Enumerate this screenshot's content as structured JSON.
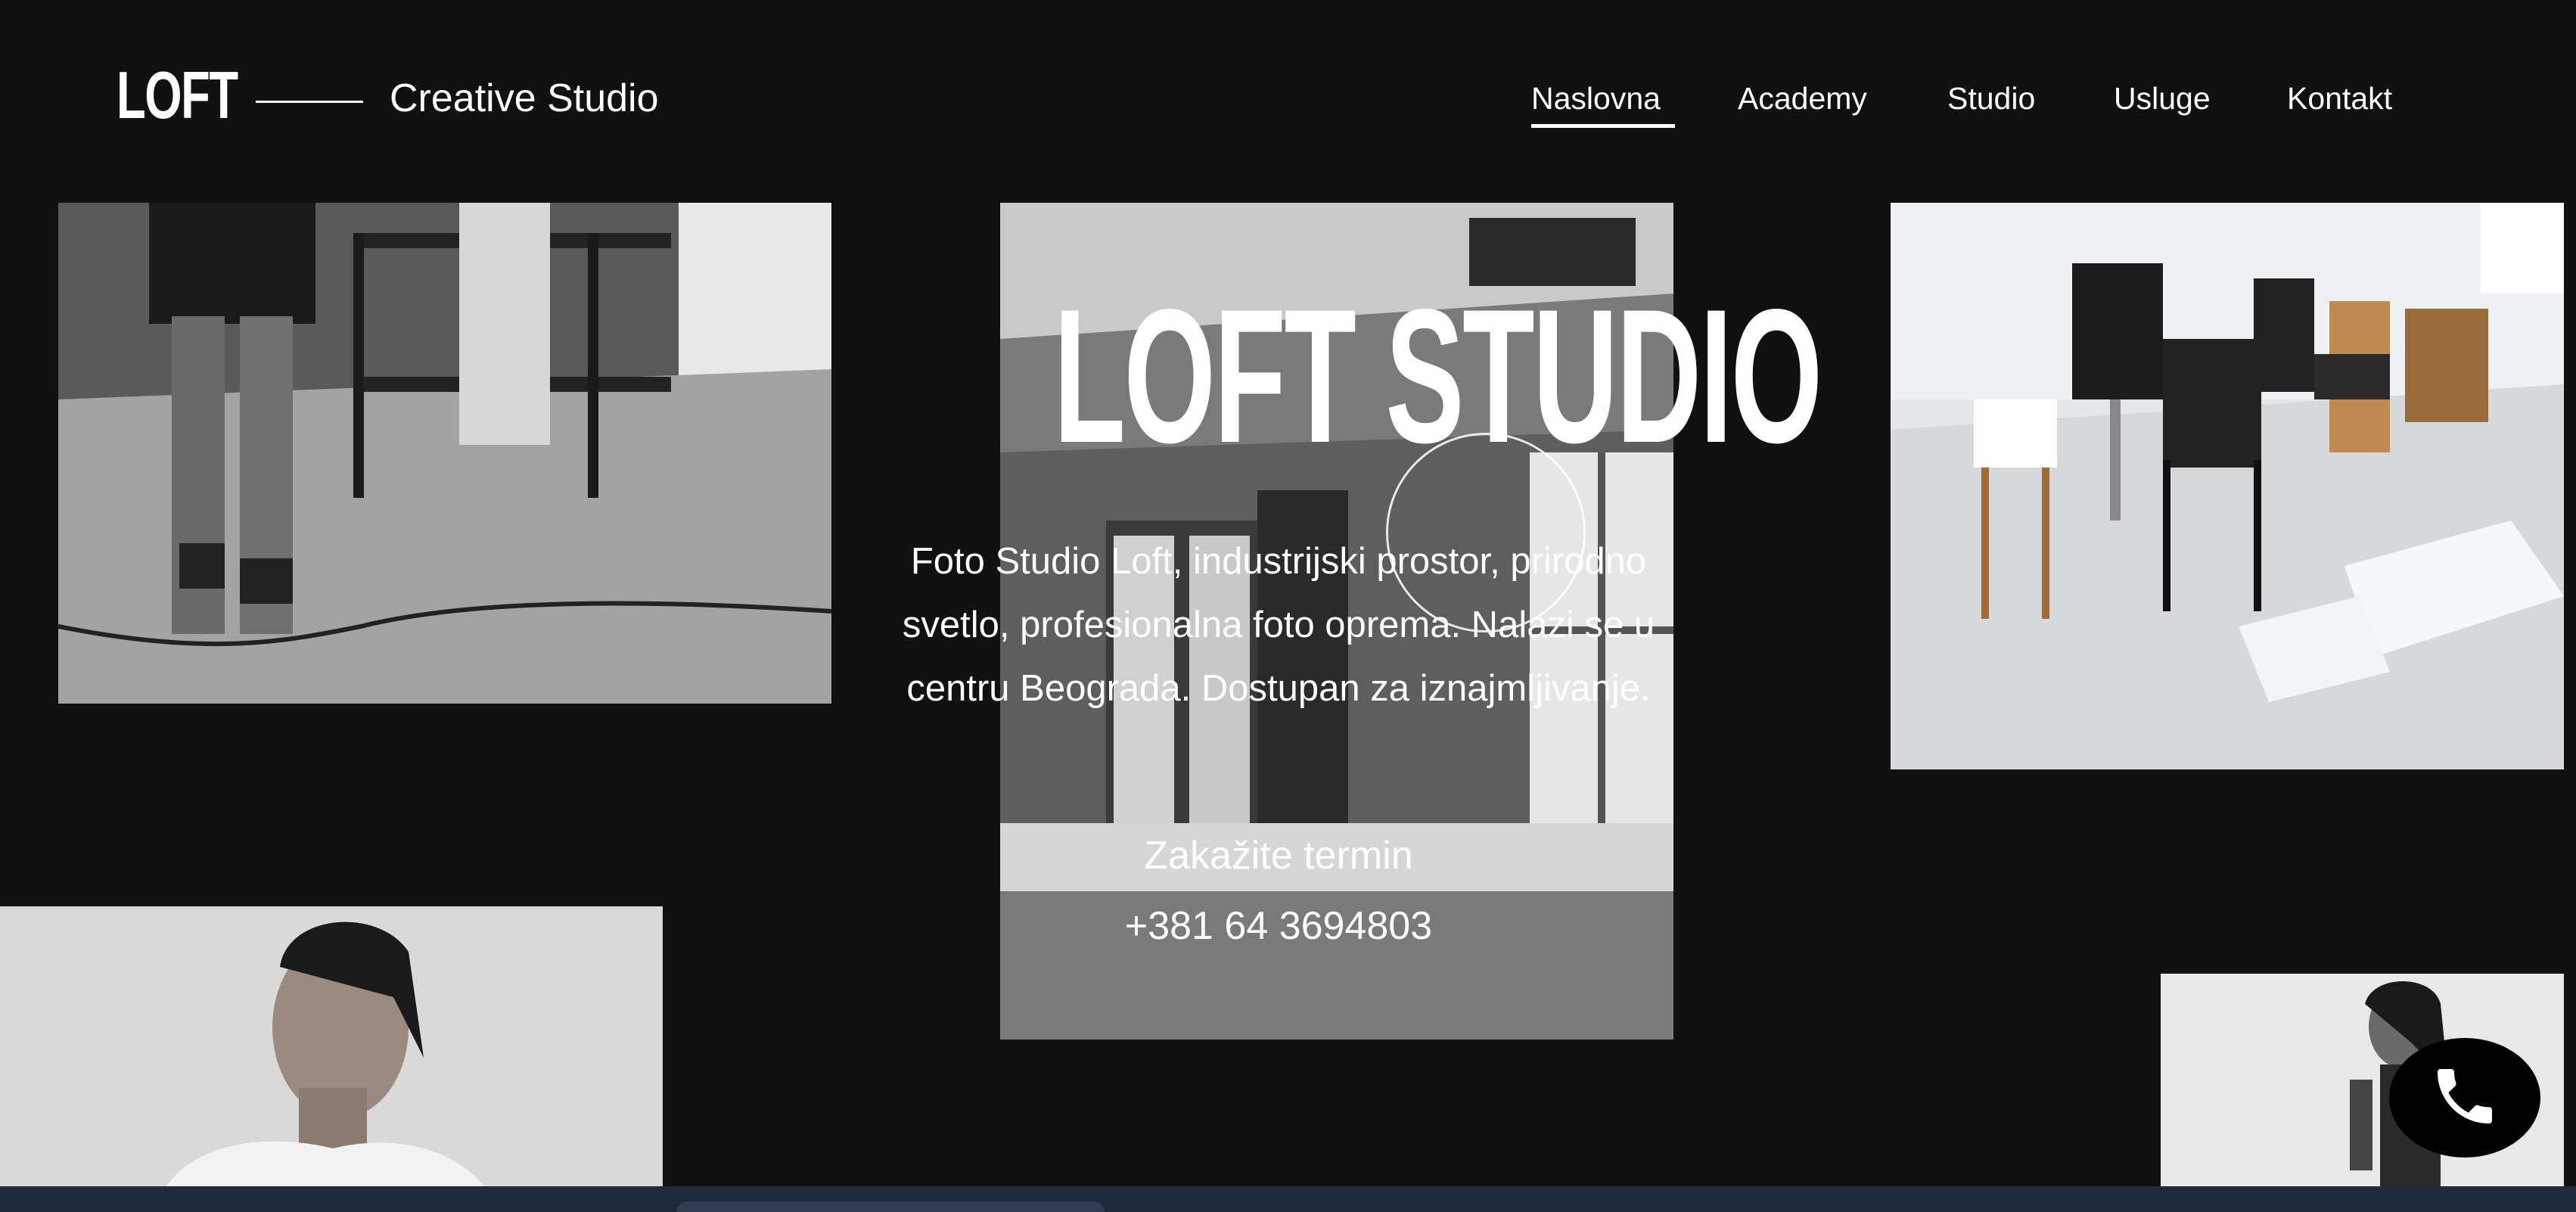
{
  "brand": {
    "logo": "LOFT",
    "tagline": "Creative Studio"
  },
  "nav": {
    "items": [
      {
        "label": "Naslovna",
        "active": true
      },
      {
        "label": "Academy",
        "active": false
      },
      {
        "label": "Studio",
        "active": false
      },
      {
        "label": "Usluge",
        "active": false
      },
      {
        "label": "Kontakt",
        "active": false
      }
    ]
  },
  "hero": {
    "title": "LOFT STUDIO",
    "description": "Foto Studio Loft, industrijski prostor, prirodno svetlo, profesionalna foto oprema. Nalazi se u centru Beograda. Dostupan za iznajmljivanje.",
    "cta": "Zakažite termin",
    "phone": "+381 64 3694803"
  },
  "icons": {
    "call": "phone-icon"
  },
  "colors": {
    "background": "#111111",
    "text": "#ffffff",
    "call_button": "#000000"
  }
}
